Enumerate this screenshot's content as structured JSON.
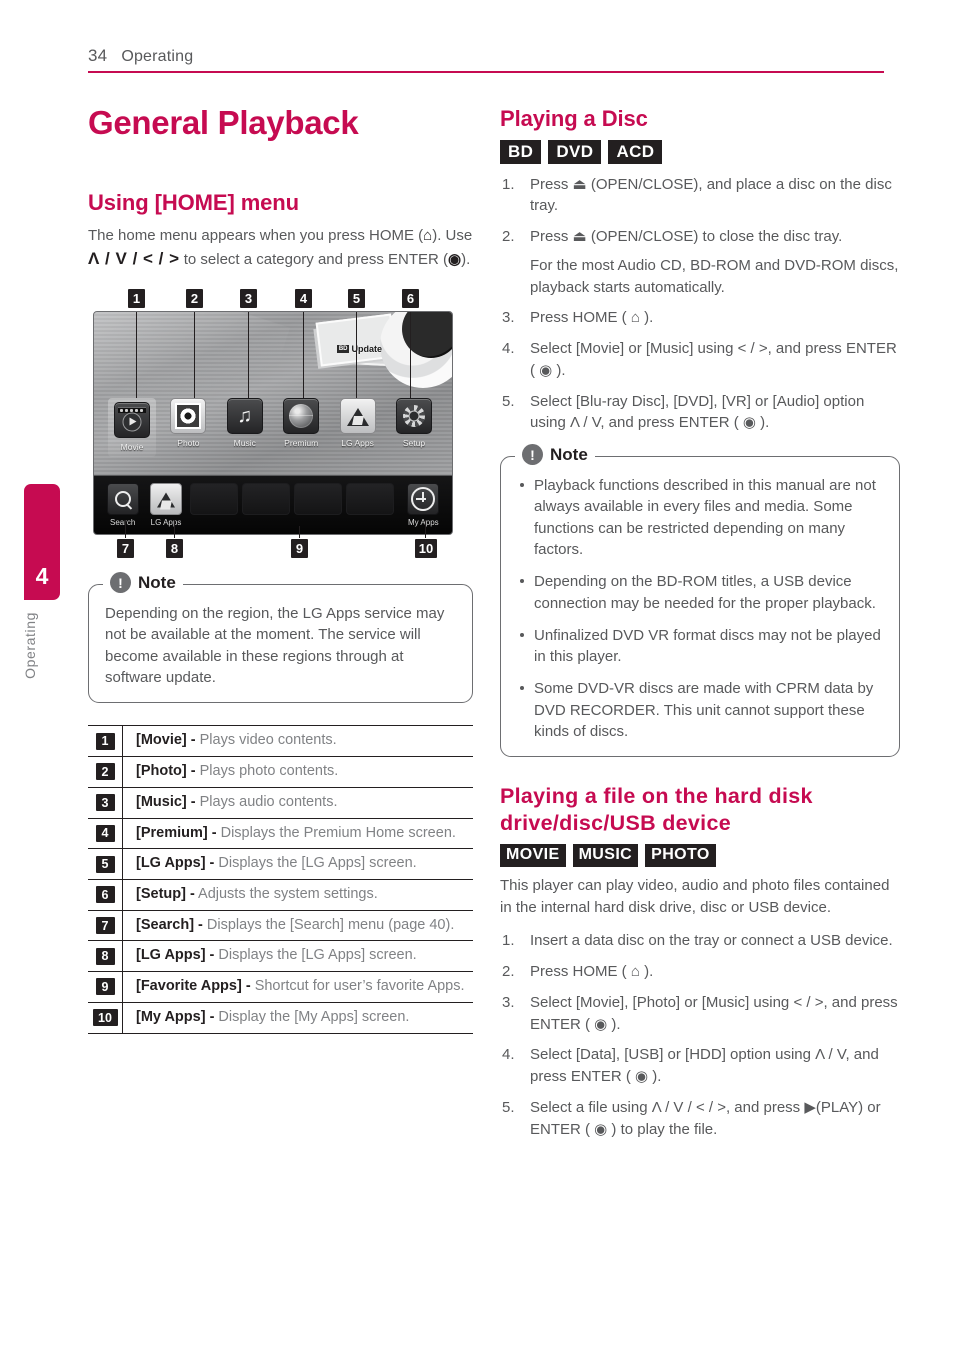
{
  "header": {
    "page_number": "34",
    "section": "Operating",
    "rule_color": "#c60b51"
  },
  "side_tab": {
    "chapter_number": "4",
    "chapter_label": "Operating",
    "color": "#c60b51"
  },
  "left_column": {
    "title": "General Playback",
    "section_heading": "Using [HOME] menu",
    "intro": {
      "part1": "The home menu appears when you press HOME (",
      "home_icon": "home-icon",
      "part2": "). Use ",
      "dpad": "Λ / V / < / >",
      "part3": " to select a category and press ENTER (",
      "enter_icon": "enter-icon",
      "part4": ")."
    },
    "screenshot": {
      "callouts_top": [
        "1",
        "2",
        "3",
        "4",
        "5",
        "6"
      ],
      "callouts_bottom": [
        "7",
        "8",
        "9",
        "10"
      ],
      "bd_update_chip": "BD",
      "bd_update_label": "Update",
      "main_icons": [
        {
          "label": "Movie",
          "icon": "movie-icon",
          "selected": true
        },
        {
          "label": "Photo",
          "icon": "photo-icon",
          "selected": false
        },
        {
          "label": "Music",
          "icon": "music-icon",
          "selected": false
        },
        {
          "label": "Premium",
          "icon": "premium-globe-icon",
          "selected": false
        },
        {
          "label": "LG Apps",
          "icon": "lg-apps-icon",
          "selected": false
        },
        {
          "label": "Setup",
          "icon": "setup-gear-icon",
          "selected": false
        }
      ],
      "dock_icons": [
        {
          "label": "Search",
          "icon": "search-icon"
        },
        {
          "label": "LG Apps",
          "icon": "lg-apps-icon"
        },
        {
          "label": "My Apps",
          "icon": "plus-circle-icon"
        }
      ]
    },
    "note": {
      "title": "Note",
      "text": "Depending on the region, the LG Apps service may not be available at the moment. The service will become available in these regions through at software update."
    },
    "legend": [
      {
        "num": "1",
        "term": "[Movie] -",
        "desc": " Plays video contents."
      },
      {
        "num": "2",
        "term": "[Photo] -",
        "desc": " Plays photo contents."
      },
      {
        "num": "3",
        "term": "[Music] -",
        "desc": " Plays audio contents."
      },
      {
        "num": "4",
        "term": "[Premium] -",
        "desc": " Displays the Premium Home screen."
      },
      {
        "num": "5",
        "term": "[LG Apps] -",
        "desc": " Displays the [LG Apps] screen."
      },
      {
        "num": "6",
        "term": "[Setup] -",
        "desc": " Adjusts the system settings."
      },
      {
        "num": "7",
        "term": "[Search] -",
        "desc": " Displays the [Search] menu (page 40)."
      },
      {
        "num": "8",
        "term": "[LG Apps] -",
        "desc": " Displays the [LG Apps] screen."
      },
      {
        "num": "9",
        "term": "[Favorite Apps] -",
        "desc": " Shortcut for user’s favorite Apps."
      },
      {
        "num": "10",
        "term": "[My Apps] -",
        "desc": " Display the [My Apps] screen."
      }
    ]
  },
  "right_column": {
    "section1": {
      "heading": "Playing a Disc",
      "badges": [
        "BD",
        "DVD",
        "ACD"
      ],
      "steps": [
        {
          "num": "1",
          "html": "Press ⏏ (OPEN/CLOSE), and place a disc on the disc tray."
        },
        {
          "num": "2",
          "html": "Press ⏏ (OPEN/CLOSE) to close the disc tray."
        },
        {
          "num": "3",
          "html": "Press HOME ( ⌂ )."
        },
        {
          "num": "4",
          "html": "Select [Movie] or [Music] using < / >, and press ENTER ( ◉ )."
        },
        {
          "num": "5",
          "html": "Select [Blu-ray Disc], [DVD], [VR] or [Audio] option using Λ / V, and press ENTER ( ◉ )."
        }
      ],
      "substep_after_2": "For the most Audio CD, BD-ROM and DVD-ROM discs, playback starts automatically."
    },
    "note": {
      "title": "Note",
      "bullets": [
        "Playback functions described in this manual are not always available in every files and media. Some functions can be restricted depending on many factors.",
        "Depending on the BD-ROM titles, a USB device connection may be needed for the proper playback.",
        "Unfinalized DVD VR format discs may not be played in this player.",
        "Some DVD-VR discs are made with CPRM data by DVD RECORDER. This unit cannot support these kinds of discs."
      ]
    },
    "section2": {
      "heading_line1": "Playing a file on the hard disk",
      "heading_line2": "drive/disc/USB device",
      "badges": [
        "MOVIE",
        "MUSIC",
        "PHOTO"
      ],
      "intro": "This player can play video, audio and photo files contained in the internal hard disk drive, disc or USB device.",
      "steps": [
        {
          "num": "1",
          "html": "Insert a data disc on the tray or connect a USB device."
        },
        {
          "num": "2",
          "html": "Press HOME ( ⌂ )."
        },
        {
          "num": "3",
          "html": "Select [Movie], [Photo] or [Music] using < / >, and press ENTER ( ◉ )."
        },
        {
          "num": "4",
          "html": "Select [Data], [USB] or [HDD] option using Λ / V, and press ENTER ( ◉ )."
        },
        {
          "num": "5",
          "html": "Select a file using Λ / V / < / >, and press ▶(PLAY) or ENTER ( ◉ ) to play the file."
        }
      ]
    }
  }
}
